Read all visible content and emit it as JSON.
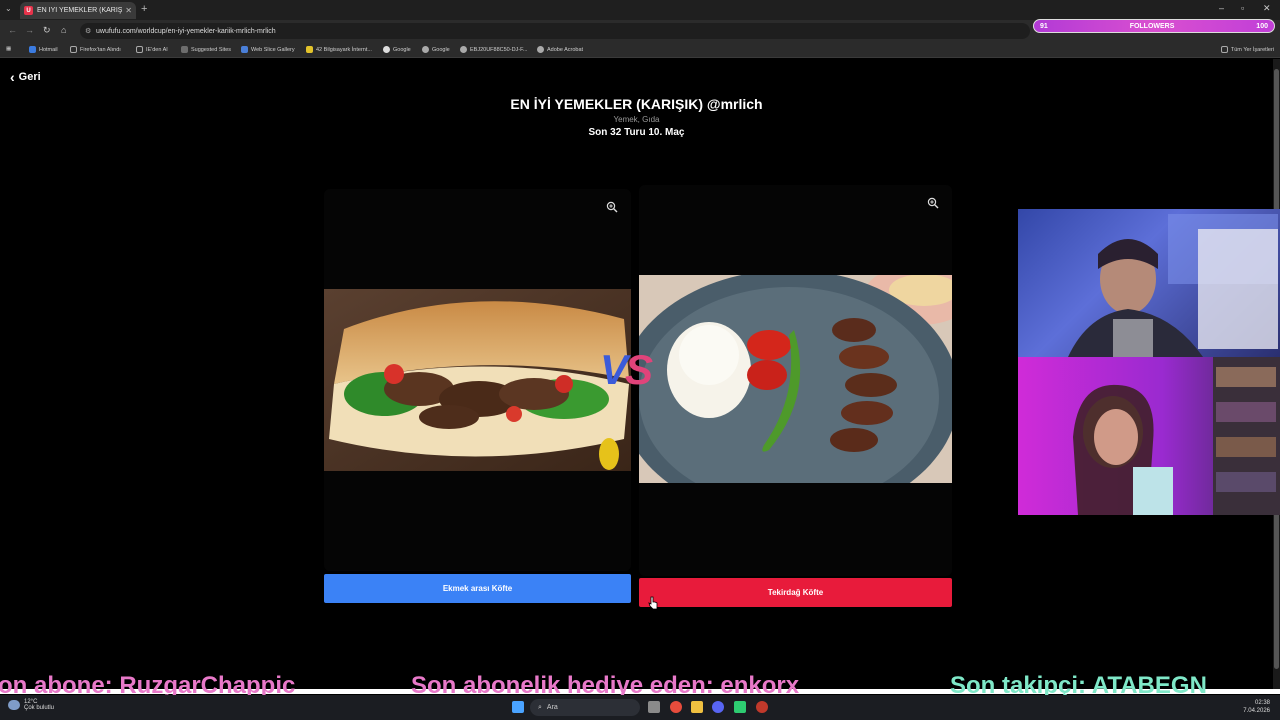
{
  "browser": {
    "tab_title": "EN İYİ YEMEKLER (KARIŞIK) @m",
    "tab_favicon": "U",
    "url": "uwufufu.com/worldcup/en-iyi-yemekler-kariik-mrlich-mrlich",
    "bookmarks": [
      "Hotmail",
      "Firefox'tan Alındı",
      "IE'den Al",
      "Suggested Sites",
      "Web Slice Gallery",
      "42 Bilgisayark İnternt...",
      "Google",
      "Google",
      "EBJ20UF88C50-DJ-F...",
      "Adobe Acrobat"
    ],
    "all_bookmarks": "Tüm Yer İşaretleri"
  },
  "overlay": {
    "followers_label": "FOLLOWERS",
    "followers_current": "91",
    "followers_goal": "100",
    "ticker": {
      "sub": "on abone: RuzgarChappic",
      "gift": "Son abonelik hediye eden: enkorx",
      "follow": "Son takipçi: ATABEGN"
    }
  },
  "page": {
    "back_label": "Geri",
    "title": "EN İYİ YEMEKLER (KARIŞIK) @mrlich",
    "subtitle": "Yemek, Gıda",
    "round": "Son 32 Turu 10. Maç",
    "vs_v": "V",
    "vs_s": "S",
    "left_choice": "Ekmek arası Köfte",
    "right_choice": "Tekirdağ Köfte",
    "left_color": "#3b82f6",
    "right_color": "#e81b3b"
  },
  "taskbar": {
    "temp": "12°C",
    "weather": "Çok bulutlu",
    "search": "Ara",
    "time": "02:38",
    "date": "7.04.2026"
  }
}
